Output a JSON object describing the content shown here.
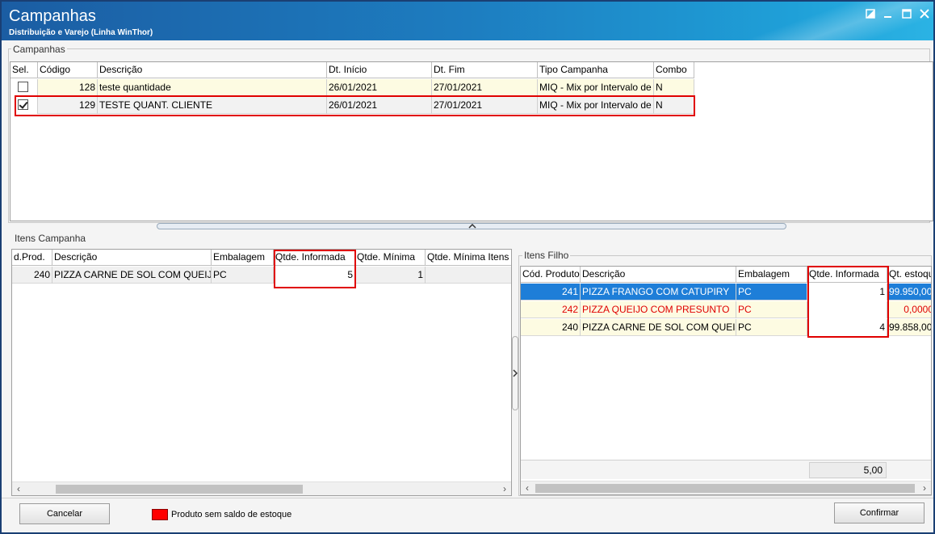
{
  "window": {
    "title": "Campanhas",
    "subtitle": "Distribuição e Varejo (Linha WinThor)"
  },
  "campanhas": {
    "label": "Campanhas",
    "columns": [
      "Sel.",
      "Código",
      "Descrição",
      "Dt. Início",
      "Dt. Fim",
      "Tipo Campanha",
      "Combo"
    ],
    "rows": [
      {
        "checked": false,
        "codigo": "128",
        "descricao": "teste quantidade",
        "inicio": "26/01/2021",
        "fim": "27/01/2021",
        "tipo": "MIQ - Mix por Intervalo de",
        "combo": "N"
      },
      {
        "checked": true,
        "codigo": "129",
        "descricao": "TESTE QUANT. CLIENTE",
        "inicio": "26/01/2021",
        "fim": "27/01/2021",
        "tipo": "MIQ - Mix por Intervalo de",
        "combo": "N"
      }
    ]
  },
  "itens_campanha": {
    "label": "Itens Campanha",
    "columns": [
      "d.Prod.",
      "Descrição",
      "Embalagem",
      "Qtde. Informada",
      "Qtde. Mínima",
      "Qtde. Mínima Itens"
    ],
    "rows": [
      {
        "cod": "240",
        "descricao": "PIZZA CARNE DE SOL COM QUEIJO",
        "embalagem": "PC",
        "informada": "5",
        "minima": "1",
        "minima_itens": ""
      }
    ]
  },
  "itens_filho": {
    "label": "Itens Filho",
    "columns": [
      "Cód. Produto",
      "Descrição",
      "Embalagem",
      "Qtde. Informada",
      "Qt. estoque"
    ],
    "rows": [
      {
        "cod": "241",
        "descricao": "PIZZA FRANGO COM CATUPIRY",
        "embalagem": "PC",
        "informada": "1",
        "estoque": "99.950,00"
      },
      {
        "cod": "242",
        "descricao": "PIZZA QUEIJO COM PRESUNTO",
        "embalagem": "PC",
        "informada": "",
        "estoque": "0,0000"
      },
      {
        "cod": "240",
        "descricao": "PIZZA CARNE DE SOL COM QUEIJO",
        "embalagem": "PC",
        "informada": "4",
        "estoque": "99.858,00"
      }
    ],
    "total": "5,00"
  },
  "footer": {
    "cancel_label": "Cancelar",
    "confirm_label": "Confirmar",
    "legend_label": "Produto sem saldo  de estoque"
  },
  "colors": {
    "selected_row": "#1e7ed8",
    "cream_row": "#fdfbe2",
    "highlight": "#e00000",
    "title_bar": "#1b5da3"
  },
  "icons": [
    "restore-icon",
    "minimize-icon",
    "maximize-icon",
    "close-icon",
    "chevron-up-icon",
    "chevron-right-icon",
    "chevron-left-icon"
  ]
}
